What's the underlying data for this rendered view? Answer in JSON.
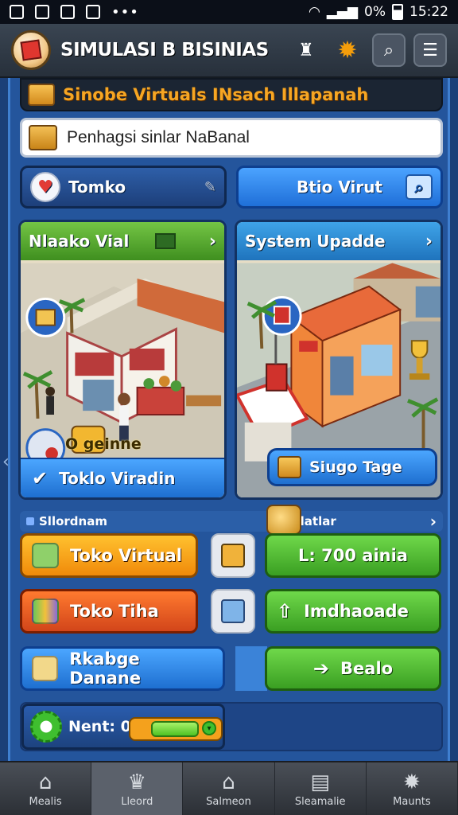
{
  "statusbar": {
    "battery": "0%",
    "time": "15:22",
    "dots": "•••"
  },
  "appbar": {
    "title": "SIMULASI B BISINIAS"
  },
  "banner": {
    "text": "Sinobe Virtuals INsach Illapanah"
  },
  "search": {
    "value": "Penhagsi sinlar NaBanal"
  },
  "pills": {
    "left": "Tomko",
    "right": "Btio Virut"
  },
  "cards": {
    "left": {
      "title": "Nlaako Vial",
      "badge": "O geinne",
      "footer": "Toklo Viradin"
    },
    "right": {
      "title": "System Upadde",
      "action": "Siugo Tage"
    }
  },
  "section": {
    "left": "Sllordnam",
    "right": "B Flatlar"
  },
  "buttons": {
    "toko_virtual": "Toko Virtual",
    "toko_tiha": "Toko Tiha",
    "rkabge_danane": "Rkabge Danane",
    "stat": "L: 700 ainia",
    "imdhaoade": "Imdhaoade",
    "bealo": "Bealo"
  },
  "meter": {
    "label": "Nent: 0",
    "fill_fraction": 0.72
  },
  "nav": [
    "Mealis",
    "Lleord",
    "Salmeon",
    "Sleamalie",
    "Maunts"
  ],
  "colors": {
    "accent_orange": "#f6a623",
    "primary_blue": "#1f6fd8",
    "green": "#3a9f22"
  }
}
